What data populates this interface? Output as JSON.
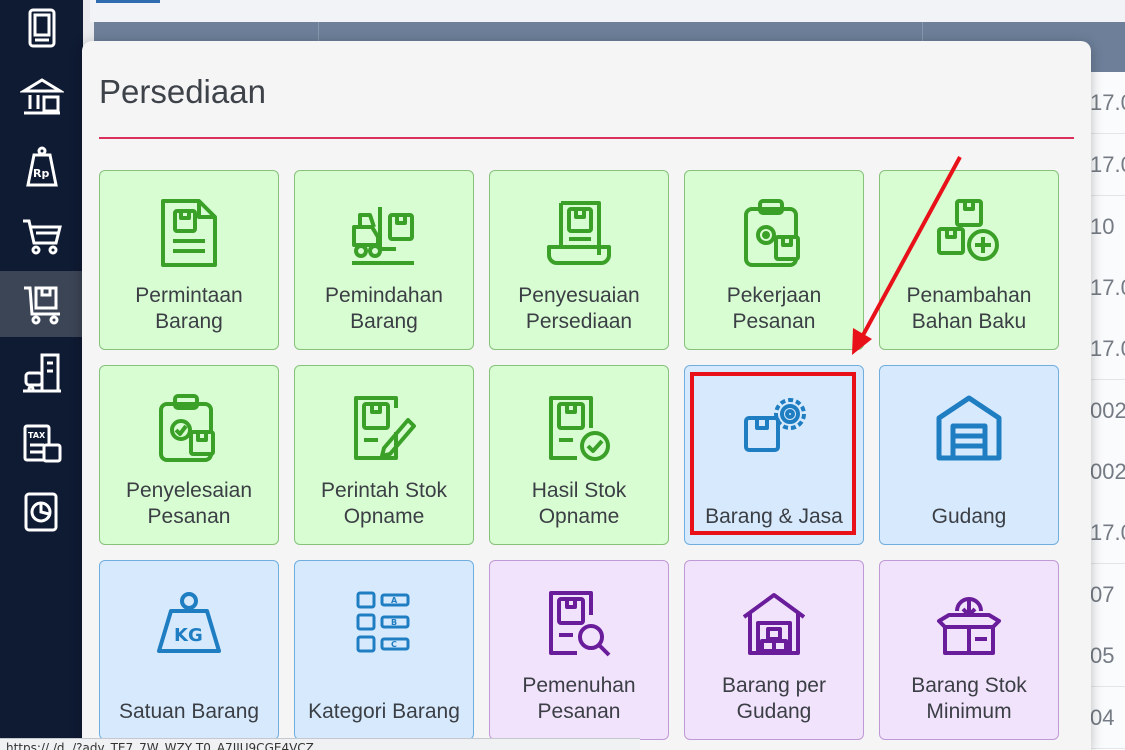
{
  "colors": {
    "sidebar_bg": "#0f1a33",
    "accent": "#d9305e",
    "annotation": "#e8111a",
    "green_icon": "#3aa028",
    "blue_icon": "#1f7dc2",
    "purple_icon": "#6a1d9b"
  },
  "sidebar": {
    "items": [
      {
        "icon": "ledger-book-icon"
      },
      {
        "icon": "bank-building-icon"
      },
      {
        "icon": "price-tag-rp-icon"
      },
      {
        "icon": "shopping-cart-icon"
      },
      {
        "icon": "inventory-cart-icon",
        "active": true
      },
      {
        "icon": "assets-building-icon"
      },
      {
        "icon": "tax-calculator-icon"
      },
      {
        "icon": "report-chart-icon"
      }
    ]
  },
  "background": {
    "right_column_values": [
      "17.0",
      "17.0",
      "10",
      "17.0",
      "17.0",
      "002",
      "002",
      "17.0",
      "07",
      "05",
      "04"
    ],
    "status_url": "https://                    /d.                       /?adv_TE7_7W_WZY    T0_A7IIU9CGE4VCZ"
  },
  "modal": {
    "title": "Persediaan",
    "tiles": [
      {
        "label": "Permintaan\nBarang",
        "color": "green",
        "icon": "document-box-icon"
      },
      {
        "label": "Pemindahan\nBarang",
        "color": "green",
        "icon": "forklift-icon"
      },
      {
        "label": "Penyesuaian\nPersediaan",
        "color": "green",
        "icon": "adjustment-scroll-icon"
      },
      {
        "label": "Pekerjaan\nPesanan",
        "color": "green",
        "icon": "work-order-clipboard-icon"
      },
      {
        "label": "Penambahan\nBahan Baku",
        "color": "green",
        "icon": "add-material-icon"
      },
      {
        "label": "Penyelesaian\nPesanan",
        "color": "green",
        "icon": "order-complete-clipboard-icon"
      },
      {
        "label": "Perintah Stok\nOpname",
        "color": "green",
        "icon": "stock-opname-pencil-icon"
      },
      {
        "label": "Hasil Stok\nOpname",
        "color": "green",
        "icon": "stock-opname-check-icon"
      },
      {
        "label": "Barang & Jasa",
        "color": "blue",
        "icon": "item-gear-icon"
      },
      {
        "label": "Gudang",
        "color": "blue",
        "icon": "warehouse-icon"
      },
      {
        "label": "Satuan Barang",
        "color": "blue",
        "icon": "kg-weight-icon"
      },
      {
        "label": "Kategori Barang",
        "color": "blue",
        "icon": "category-grid-icon"
      },
      {
        "label": "Pemenuhan\nPesanan",
        "color": "purple",
        "icon": "order-search-icon"
      },
      {
        "label": "Barang per\nGudang",
        "color": "purple",
        "icon": "warehouse-stock-icon"
      },
      {
        "label": "Barang Stok\nMinimum",
        "color": "purple",
        "icon": "min-stock-box-icon"
      }
    ]
  }
}
